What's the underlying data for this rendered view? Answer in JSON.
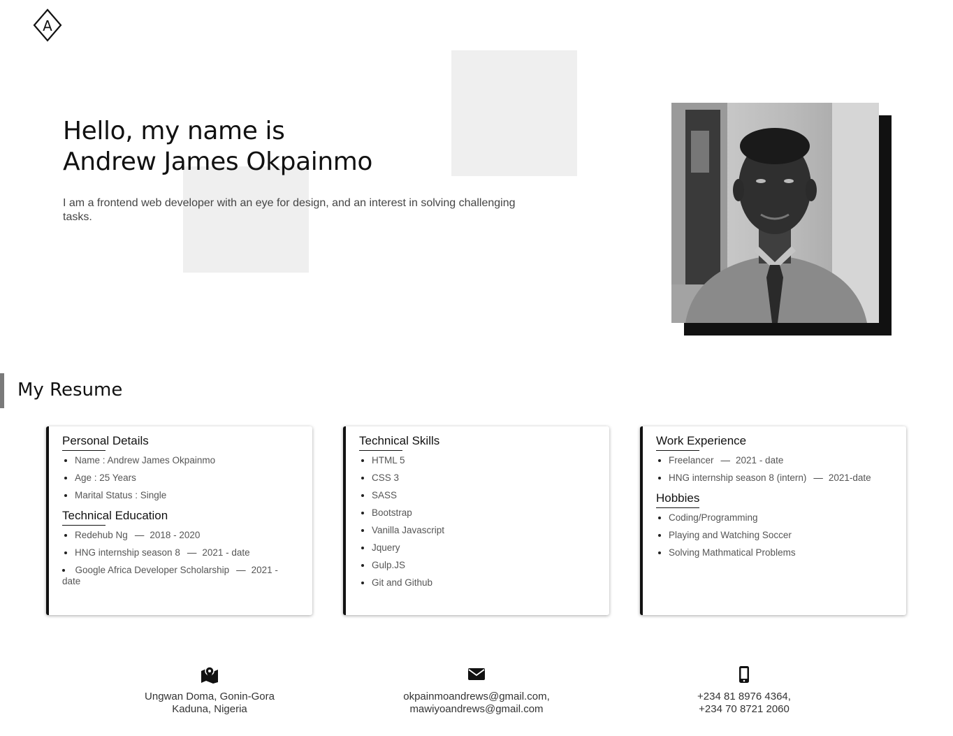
{
  "logo": {
    "letter": "A"
  },
  "hero": {
    "title_line1": "Hello, my name is",
    "title_line2": "Andrew James Okpainmo",
    "description": "I am a frontend web developer with an eye for design, and an interest in solving challenging tasks."
  },
  "resume": {
    "title": "My Resume",
    "personal": {
      "title": "Personal Details",
      "items": [
        "Name : Andrew James Okpainmo",
        "Age : 25 Years",
        "Marital Status : Single"
      ]
    },
    "education": {
      "title": "Technical Education",
      "items": [
        {
          "name": "Redehub Ng",
          "period": "2018 - 2020"
        },
        {
          "name": "HNG internship season 8",
          "period": "2021 - date"
        },
        {
          "name": "Google Africa Developer Scholarship",
          "period": "2021 - date"
        }
      ]
    },
    "skills": {
      "title": "Technical Skills",
      "items": [
        "HTML 5",
        "CSS 3",
        "SASS",
        "Bootstrap",
        "Vanilla Javascript",
        "Jquery",
        "Gulp.JS",
        "Git and Github"
      ]
    },
    "work": {
      "title": "Work Experience",
      "items": [
        {
          "name": "Freelancer",
          "period": "2021 - date"
        },
        {
          "name": "HNG internship season 8 (intern)",
          "period": "2021-date"
        }
      ]
    },
    "hobbies": {
      "title": "Hobbies",
      "items": [
        "Coding/Programming",
        "Playing and Watching Soccer",
        "Solving Mathmatical Problems"
      ]
    }
  },
  "contact": {
    "address": {
      "icon": "map-marker-icon",
      "line1": "Ungwan Doma, Gonin-Gora",
      "line2": "Kaduna, Nigeria"
    },
    "email": {
      "icon": "envelope-icon",
      "line1": "okpainmoandrews@gmail.com,",
      "line2": "mawiyoandrews@gmail.com"
    },
    "phone": {
      "icon": "mobile-phone-icon",
      "line1": "+234 81 8976 4364,",
      "line2": "+234 70 8721 2060"
    }
  },
  "colors": {
    "text": "#111111",
    "accent": "#111111",
    "muted": "#555555",
    "deco": "#efefef"
  }
}
